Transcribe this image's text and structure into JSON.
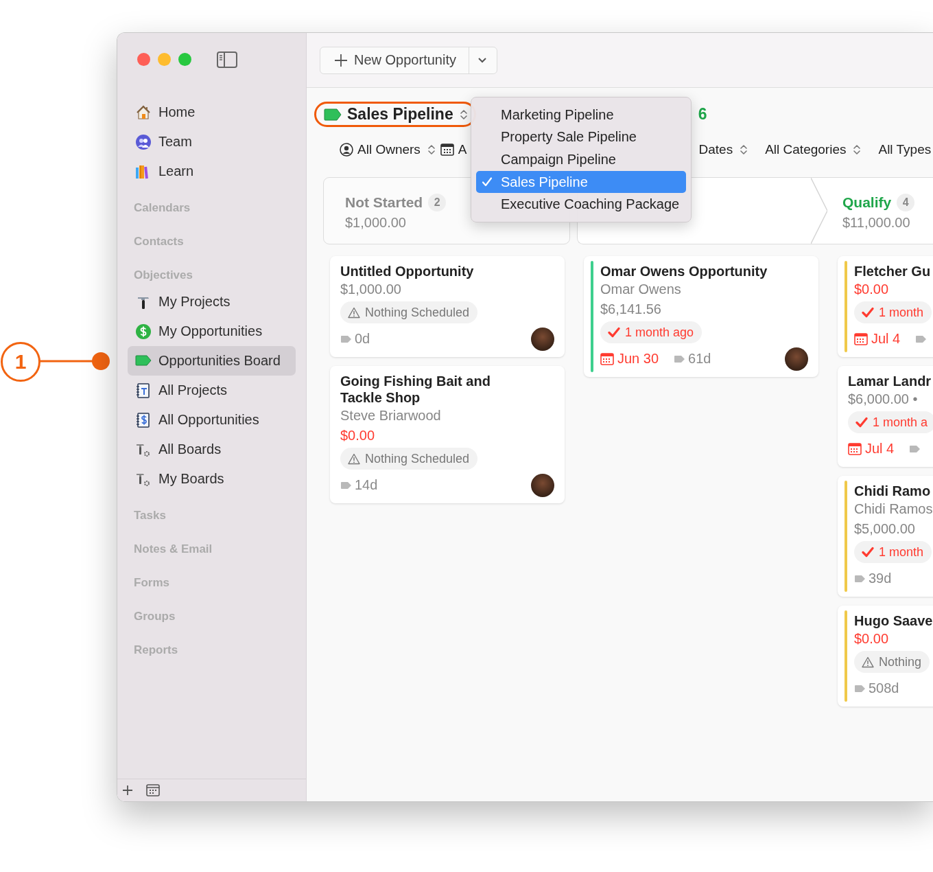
{
  "toolbar": {
    "new_button": "New Opportunity"
  },
  "sidebar": {
    "items": [
      {
        "kind": "item",
        "label": "Home",
        "selected": false
      },
      {
        "kind": "item",
        "label": "Team",
        "selected": false
      },
      {
        "kind": "item",
        "label": "Learn",
        "selected": false
      },
      {
        "kind": "header",
        "label": "Calendars"
      },
      {
        "kind": "header",
        "label": "Contacts"
      },
      {
        "kind": "header",
        "label": "Objectives"
      },
      {
        "kind": "item",
        "label": "My Projects",
        "selected": false
      },
      {
        "kind": "item",
        "label": "My Opportunities",
        "selected": false
      },
      {
        "kind": "item",
        "label": "Opportunities Board",
        "selected": true
      },
      {
        "kind": "item",
        "label": "All Projects",
        "selected": false
      },
      {
        "kind": "item",
        "label": "All Opportunities",
        "selected": false
      },
      {
        "kind": "item",
        "label": "All Boards",
        "selected": false
      },
      {
        "kind": "item",
        "label": "My Boards",
        "selected": false
      },
      {
        "kind": "header",
        "label": "Tasks"
      },
      {
        "kind": "header",
        "label": "Notes & Email"
      },
      {
        "kind": "header",
        "label": "Forms"
      },
      {
        "kind": "header",
        "label": "Groups"
      },
      {
        "kind": "header",
        "label": "Reports"
      }
    ]
  },
  "header": {
    "pipeline": "Sales Pipeline",
    "count": "6"
  },
  "filters": [
    {
      "kind": "person",
      "label": "All Owners",
      "chevron": true
    },
    {
      "kind": "calendar",
      "label": "A",
      "chevron": false
    },
    {
      "kind": "plain",
      "label": "Dates",
      "chevron": true
    },
    {
      "kind": "plain",
      "label": "All Categories",
      "chevron": true
    },
    {
      "kind": "plain",
      "label": "All Types",
      "chevron": false
    }
  ],
  "pipeline_menu": {
    "items": [
      {
        "label": "Marketing Pipeline",
        "selected": false
      },
      {
        "label": "Property Sale Pipeline",
        "selected": false
      },
      {
        "label": "Campaign Pipeline",
        "selected": false
      },
      {
        "label": "Sales Pipeline",
        "selected": true
      },
      {
        "label": "Executive Coaching Package",
        "selected": false
      }
    ]
  },
  "stages": [
    {
      "name": "Not Started",
      "count": "2",
      "amount": "$1,000.00",
      "active": false
    },
    {
      "name": "Qualify",
      "count": "4",
      "amount": "$11,000.00",
      "active": true
    }
  ],
  "columns": [
    {
      "cards": [
        {
          "title": "Untitled Opportunity",
          "amount": "$1,000.00",
          "overdue": false,
          "status": {
            "kind": "warning",
            "text": "Nothing Scheduled"
          },
          "age": "0d",
          "avatar": true
        },
        {
          "title": "Going Fishing Bait and Tackle Shop",
          "subtitle": "Steve Briarwood",
          "amount": "$0.00",
          "overdue": true,
          "status": {
            "kind": "warning",
            "text": "Nothing Scheduled"
          },
          "age": "14d",
          "avatar": true
        }
      ]
    },
    {
      "cards": [
        {
          "title": "Omar Owens Opportunity",
          "subtitle": "Omar Owens",
          "amount": "$6,141.56",
          "overdue": false,
          "status": {
            "kind": "done",
            "text": "1 month ago"
          },
          "date": "Jun 30",
          "age": "61d",
          "color": "#3ecf8e",
          "avatar": true
        }
      ]
    },
    {
      "cards": [
        {
          "title": "Fletcher Gu",
          "amount": "$0.00",
          "overdue": true,
          "status": {
            "kind": "done",
            "text": "1 month"
          },
          "date": "Jul 4",
          "color": "#f0c94a",
          "avatar": false
        },
        {
          "title": "Lamar Landr",
          "amount": "$6,000.00 •",
          "overdue": false,
          "status": {
            "kind": "done",
            "text": "1 month a"
          },
          "date": "Jul 4",
          "avatar": false
        },
        {
          "title": "Chidi Ramo",
          "subtitle": "Chidi Ramos",
          "amount": "$5,000.00",
          "overdue": false,
          "status": {
            "kind": "done",
            "text": "1 month"
          },
          "age": "39d",
          "color": "#f0c94a",
          "avatar": false
        },
        {
          "title": "Hugo Saave",
          "amount": "$0.00",
          "overdue": true,
          "status": {
            "kind": "warning",
            "text": "Nothing"
          },
          "age": "508d",
          "color": "#f0c94a",
          "avatar": false
        }
      ]
    }
  ],
  "callout": {
    "number": "1"
  }
}
